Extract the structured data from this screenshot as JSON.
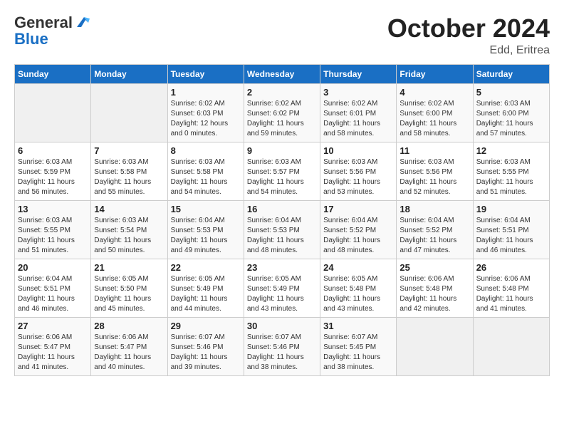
{
  "logo": {
    "general": "General",
    "blue": "Blue"
  },
  "title": "October 2024",
  "subtitle": "Edd, Eritrea",
  "days_of_week": [
    "Sunday",
    "Monday",
    "Tuesday",
    "Wednesday",
    "Thursday",
    "Friday",
    "Saturday"
  ],
  "weeks": [
    [
      {
        "day": "",
        "sunrise": "",
        "sunset": "",
        "daylight": ""
      },
      {
        "day": "",
        "sunrise": "",
        "sunset": "",
        "daylight": ""
      },
      {
        "day": "1",
        "sunrise": "Sunrise: 6:02 AM",
        "sunset": "Sunset: 6:03 PM",
        "daylight": "Daylight: 12 hours and 0 minutes."
      },
      {
        "day": "2",
        "sunrise": "Sunrise: 6:02 AM",
        "sunset": "Sunset: 6:02 PM",
        "daylight": "Daylight: 11 hours and 59 minutes."
      },
      {
        "day": "3",
        "sunrise": "Sunrise: 6:02 AM",
        "sunset": "Sunset: 6:01 PM",
        "daylight": "Daylight: 11 hours and 58 minutes."
      },
      {
        "day": "4",
        "sunrise": "Sunrise: 6:02 AM",
        "sunset": "Sunset: 6:00 PM",
        "daylight": "Daylight: 11 hours and 58 minutes."
      },
      {
        "day": "5",
        "sunrise": "Sunrise: 6:03 AM",
        "sunset": "Sunset: 6:00 PM",
        "daylight": "Daylight: 11 hours and 57 minutes."
      }
    ],
    [
      {
        "day": "6",
        "sunrise": "Sunrise: 6:03 AM",
        "sunset": "Sunset: 5:59 PM",
        "daylight": "Daylight: 11 hours and 56 minutes."
      },
      {
        "day": "7",
        "sunrise": "Sunrise: 6:03 AM",
        "sunset": "Sunset: 5:58 PM",
        "daylight": "Daylight: 11 hours and 55 minutes."
      },
      {
        "day": "8",
        "sunrise": "Sunrise: 6:03 AM",
        "sunset": "Sunset: 5:58 PM",
        "daylight": "Daylight: 11 hours and 54 minutes."
      },
      {
        "day": "9",
        "sunrise": "Sunrise: 6:03 AM",
        "sunset": "Sunset: 5:57 PM",
        "daylight": "Daylight: 11 hours and 54 minutes."
      },
      {
        "day": "10",
        "sunrise": "Sunrise: 6:03 AM",
        "sunset": "Sunset: 5:56 PM",
        "daylight": "Daylight: 11 hours and 53 minutes."
      },
      {
        "day": "11",
        "sunrise": "Sunrise: 6:03 AM",
        "sunset": "Sunset: 5:56 PM",
        "daylight": "Daylight: 11 hours and 52 minutes."
      },
      {
        "day": "12",
        "sunrise": "Sunrise: 6:03 AM",
        "sunset": "Sunset: 5:55 PM",
        "daylight": "Daylight: 11 hours and 51 minutes."
      }
    ],
    [
      {
        "day": "13",
        "sunrise": "Sunrise: 6:03 AM",
        "sunset": "Sunset: 5:55 PM",
        "daylight": "Daylight: 11 hours and 51 minutes."
      },
      {
        "day": "14",
        "sunrise": "Sunrise: 6:03 AM",
        "sunset": "Sunset: 5:54 PM",
        "daylight": "Daylight: 11 hours and 50 minutes."
      },
      {
        "day": "15",
        "sunrise": "Sunrise: 6:04 AM",
        "sunset": "Sunset: 5:53 PM",
        "daylight": "Daylight: 11 hours and 49 minutes."
      },
      {
        "day": "16",
        "sunrise": "Sunrise: 6:04 AM",
        "sunset": "Sunset: 5:53 PM",
        "daylight": "Daylight: 11 hours and 48 minutes."
      },
      {
        "day": "17",
        "sunrise": "Sunrise: 6:04 AM",
        "sunset": "Sunset: 5:52 PM",
        "daylight": "Daylight: 11 hours and 48 minutes."
      },
      {
        "day": "18",
        "sunrise": "Sunrise: 6:04 AM",
        "sunset": "Sunset: 5:52 PM",
        "daylight": "Daylight: 11 hours and 47 minutes."
      },
      {
        "day": "19",
        "sunrise": "Sunrise: 6:04 AM",
        "sunset": "Sunset: 5:51 PM",
        "daylight": "Daylight: 11 hours and 46 minutes."
      }
    ],
    [
      {
        "day": "20",
        "sunrise": "Sunrise: 6:04 AM",
        "sunset": "Sunset: 5:51 PM",
        "daylight": "Daylight: 11 hours and 46 minutes."
      },
      {
        "day": "21",
        "sunrise": "Sunrise: 6:05 AM",
        "sunset": "Sunset: 5:50 PM",
        "daylight": "Daylight: 11 hours and 45 minutes."
      },
      {
        "day": "22",
        "sunrise": "Sunrise: 6:05 AM",
        "sunset": "Sunset: 5:49 PM",
        "daylight": "Daylight: 11 hours and 44 minutes."
      },
      {
        "day": "23",
        "sunrise": "Sunrise: 6:05 AM",
        "sunset": "Sunset: 5:49 PM",
        "daylight": "Daylight: 11 hours and 43 minutes."
      },
      {
        "day": "24",
        "sunrise": "Sunrise: 6:05 AM",
        "sunset": "Sunset: 5:48 PM",
        "daylight": "Daylight: 11 hours and 43 minutes."
      },
      {
        "day": "25",
        "sunrise": "Sunrise: 6:06 AM",
        "sunset": "Sunset: 5:48 PM",
        "daylight": "Daylight: 11 hours and 42 minutes."
      },
      {
        "day": "26",
        "sunrise": "Sunrise: 6:06 AM",
        "sunset": "Sunset: 5:48 PM",
        "daylight": "Daylight: 11 hours and 41 minutes."
      }
    ],
    [
      {
        "day": "27",
        "sunrise": "Sunrise: 6:06 AM",
        "sunset": "Sunset: 5:47 PM",
        "daylight": "Daylight: 11 hours and 41 minutes."
      },
      {
        "day": "28",
        "sunrise": "Sunrise: 6:06 AM",
        "sunset": "Sunset: 5:47 PM",
        "daylight": "Daylight: 11 hours and 40 minutes."
      },
      {
        "day": "29",
        "sunrise": "Sunrise: 6:07 AM",
        "sunset": "Sunset: 5:46 PM",
        "daylight": "Daylight: 11 hours and 39 minutes."
      },
      {
        "day": "30",
        "sunrise": "Sunrise: 6:07 AM",
        "sunset": "Sunset: 5:46 PM",
        "daylight": "Daylight: 11 hours and 38 minutes."
      },
      {
        "day": "31",
        "sunrise": "Sunrise: 6:07 AM",
        "sunset": "Sunset: 5:45 PM",
        "daylight": "Daylight: 11 hours and 38 minutes."
      },
      {
        "day": "",
        "sunrise": "",
        "sunset": "",
        "daylight": ""
      },
      {
        "day": "",
        "sunrise": "",
        "sunset": "",
        "daylight": ""
      }
    ]
  ]
}
